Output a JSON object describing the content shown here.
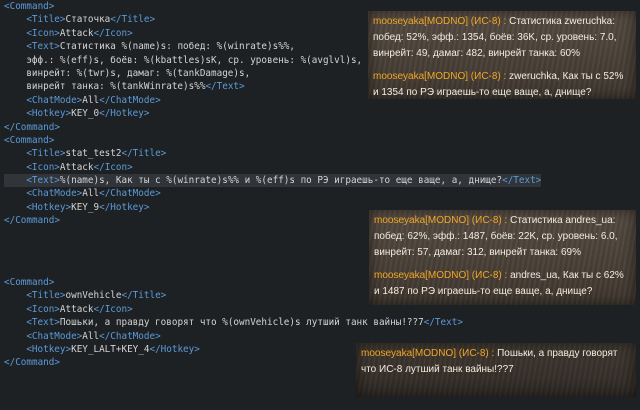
{
  "editor": {
    "block1": [
      {
        "indent": 0,
        "parts": [
          {
            "k": "tag",
            "t": "<Command>"
          }
        ]
      },
      {
        "indent": 2,
        "parts": [
          {
            "k": "tag",
            "t": "<Title>"
          },
          {
            "k": "txt",
            "t": "Статочка"
          },
          {
            "k": "tag",
            "t": "</Title>"
          }
        ]
      },
      {
        "indent": 2,
        "parts": [
          {
            "k": "tag",
            "t": "<Icon>"
          },
          {
            "k": "txt",
            "t": "Attack"
          },
          {
            "k": "tag",
            "t": "</Icon>"
          }
        ]
      },
      {
        "indent": 2,
        "parts": [
          {
            "k": "tag",
            "t": "<Text>"
          },
          {
            "k": "txt",
            "t": "Статистика %(name)s: побед: %(winrate)s%%,"
          }
        ]
      },
      {
        "indent": 2,
        "parts": [
          {
            "k": "txt",
            "t": "эфф.: %(eff)s, боёв: %(kbattles)sK, ср. уровень: %(avglvl)s,"
          }
        ]
      },
      {
        "indent": 2,
        "parts": [
          {
            "k": "txt",
            "t": "винрейт: %(twr)s, дамаг: %(tankDamage)s,"
          }
        ]
      },
      {
        "indent": 2,
        "parts": [
          {
            "k": "txt",
            "t": "винрейт танка: %(tankWinrate)s%%"
          },
          {
            "k": "tag",
            "t": "</Text>"
          }
        ]
      },
      {
        "indent": 2,
        "parts": [
          {
            "k": "tag",
            "t": "<ChatMode>"
          },
          {
            "k": "txt",
            "t": "All"
          },
          {
            "k": "tag",
            "t": "</ChatMode>"
          }
        ]
      },
      {
        "indent": 2,
        "parts": [
          {
            "k": "tag",
            "t": "<Hotkey>"
          },
          {
            "k": "txt",
            "t": "KEY_0"
          },
          {
            "k": "tag",
            "t": "</Hotkey>"
          }
        ]
      },
      {
        "indent": 0,
        "parts": [
          {
            "k": "tag",
            "t": "</Command>"
          }
        ]
      },
      {
        "indent": 0,
        "parts": [
          {
            "k": "tag",
            "t": "<Command>"
          }
        ]
      },
      {
        "indent": 2,
        "parts": [
          {
            "k": "tag",
            "t": "<Title>"
          },
          {
            "k": "txt",
            "t": "stat_test2"
          },
          {
            "k": "tag",
            "t": "</Title>"
          }
        ]
      },
      {
        "indent": 2,
        "parts": [
          {
            "k": "tag",
            "t": "<Icon>"
          },
          {
            "k": "txt",
            "t": "Attack"
          },
          {
            "k": "tag",
            "t": "</Icon>"
          }
        ]
      },
      {
        "indent": 2,
        "hl": true,
        "parts": [
          {
            "k": "tag",
            "t": "<Text>"
          },
          {
            "k": "txt",
            "t": "%(name)s, Как ты с %(winrate)s%% и %(eff)s по РЭ играешь-то еще ваще, а, днище?"
          },
          {
            "k": "tag",
            "t": "</Text>"
          }
        ]
      },
      {
        "indent": 2,
        "parts": [
          {
            "k": "tag",
            "t": "<ChatMode>"
          },
          {
            "k": "txt",
            "t": "All"
          },
          {
            "k": "tag",
            "t": "</ChatMode>"
          }
        ]
      },
      {
        "indent": 2,
        "parts": [
          {
            "k": "tag",
            "t": "<Hotkey>"
          },
          {
            "k": "txt",
            "t": "KEY_9"
          },
          {
            "k": "tag",
            "t": "</Hotkey>"
          }
        ]
      },
      {
        "indent": 0,
        "parts": [
          {
            "k": "tag",
            "t": "</Command>"
          }
        ]
      }
    ],
    "block2": [
      {
        "indent": 0,
        "parts": [
          {
            "k": "tag",
            "t": "<Command>"
          }
        ]
      },
      {
        "indent": 2,
        "parts": [
          {
            "k": "tag",
            "t": "<Title>"
          },
          {
            "k": "txt",
            "t": "ownVehicle"
          },
          {
            "k": "tag",
            "t": "</Title>"
          }
        ]
      },
      {
        "indent": 2,
        "parts": [
          {
            "k": "tag",
            "t": "<Icon>"
          },
          {
            "k": "txt",
            "t": "Attack"
          },
          {
            "k": "tag",
            "t": "</Icon>"
          }
        ]
      },
      {
        "indent": 2,
        "parts": [
          {
            "k": "tag",
            "t": "<Text>"
          },
          {
            "k": "txt",
            "t": "Пошьки, а правду говорят что %(ownVehicle)s лутший танк вайны!??7"
          },
          {
            "k": "tag",
            "t": "</Text>"
          }
        ]
      },
      {
        "indent": 2,
        "parts": [
          {
            "k": "tag",
            "t": "<ChatMode>"
          },
          {
            "k": "txt",
            "t": "All"
          },
          {
            "k": "tag",
            "t": "</ChatMode>"
          }
        ]
      },
      {
        "indent": 2,
        "parts": [
          {
            "k": "tag",
            "t": "<Hotkey>"
          },
          {
            "k": "txt",
            "t": "KEY_LALT+KEY_4"
          },
          {
            "k": "tag",
            "t": "</Hotkey>"
          }
        ]
      },
      {
        "indent": 0,
        "parts": [
          {
            "k": "tag",
            "t": "</Command>"
          }
        ]
      }
    ]
  },
  "chat": {
    "panel1": [
      {
        "nick": "mooseyaka[MODNO] (ИС-8) :",
        "text": " Статистика zweruchka: побед: 52%, эфф.: 1354, боёв: 36K, ср. уровень: 7.0, винрейт: 49, дамаг: 482, винрейт танка: 60%"
      },
      {
        "nick": "mooseyaka[MODNO] (ИС-8) :",
        "text": " zweruchka, Как ты с 52% и 1354 по РЭ играешь-то еще ваще, а, днище?"
      }
    ],
    "panel2": [
      {
        "nick": "mooseyaka[MODNO] (ИС-8) :",
        "text": " Статистика andres_ua: побед: 62%, эфф.: 1487, боёв: 22K, ср. уровень: 6.0, винрейт: 57, дамаг: 312, винрейт танка: 69%"
      },
      {
        "nick": "mooseyaka[MODNO] (ИС-8) :",
        "text": " andres_ua, Как ты с 62% и 1487 по РЭ играешь-то еще ваще, а, днище?"
      }
    ],
    "panel3": [
      {
        "nick": "mooseyaka[MODNO] (ИС-8) :",
        "text": " Пошьки, а правду говорят что ИС-8 лутший танк вайны!??7"
      }
    ]
  },
  "colors": {
    "editor_bg": "#1e2124",
    "xml_tag": "#5c9ad8",
    "code_text": "#d4d4d4",
    "highlight_line": "#31353a",
    "chat_nick": "#f1a726",
    "chat_text": "#f3ece0"
  }
}
